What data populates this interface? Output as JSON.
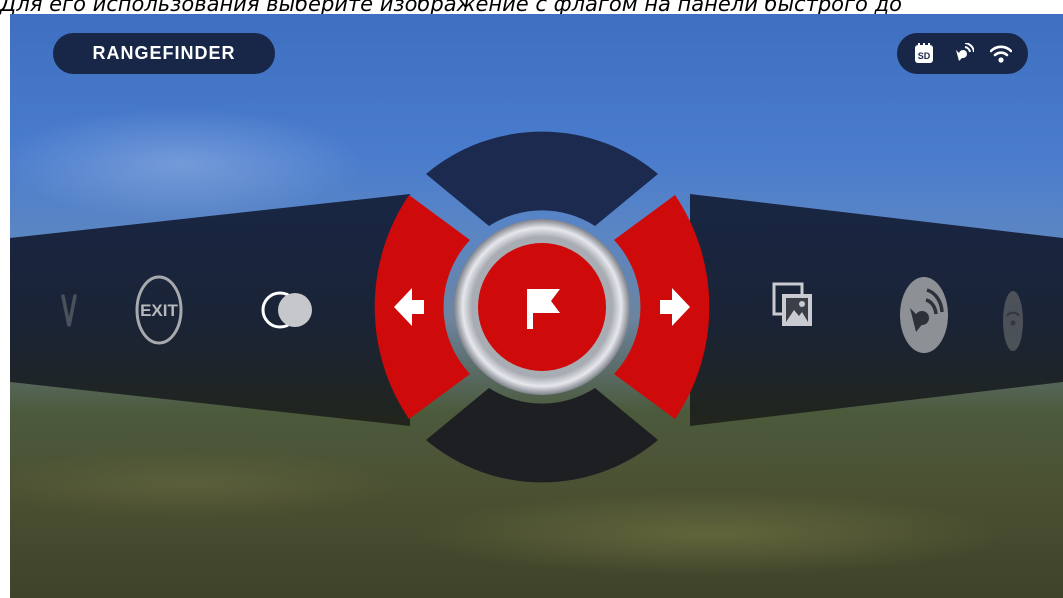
{
  "caption": "Для его использования выберите изображение с флагом на панели быстрого до",
  "header": {
    "mode_label": "RANGEFINDER"
  },
  "status_bar": {
    "icons": [
      "sd-card-icon",
      "satellite-icon",
      "wifi-icon"
    ],
    "sd_label": "SD"
  },
  "menu": {
    "exit_label": "EXIT",
    "items_left": [
      "chevron-down-icon",
      "exit-icon",
      "contrast-icon"
    ],
    "items_right": [
      "gallery-icon",
      "satellite-icon",
      "wifi-icon"
    ],
    "selected": "flag-icon"
  },
  "colors": {
    "accent_red": "#cf0a0a",
    "navy": "#182747",
    "silver": "#c9ccd2"
  }
}
